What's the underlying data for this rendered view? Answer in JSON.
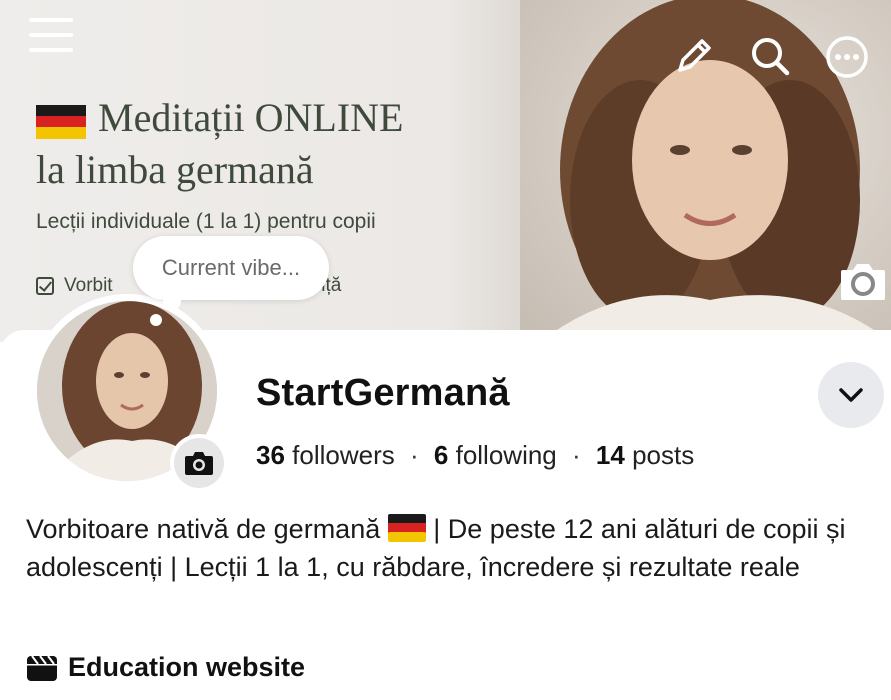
{
  "cover": {
    "title_line1": "Meditații ONLINE",
    "title_line2": "la limba germană",
    "subtitle": "Lecții individuale (1 la 1) pentru copii",
    "check_left": "Vorbit",
    "check_right": "experiență",
    "flag_icon": "germany-flag-icon"
  },
  "note": {
    "text": "Current vibe..."
  },
  "profile": {
    "name": "StartGermană",
    "followers_count": "36",
    "followers_label": "followers",
    "following_count": "6",
    "following_label": "following",
    "posts_count": "14",
    "posts_label": "posts",
    "separator": "·"
  },
  "bio": {
    "part1": "Vorbitoare nativă de germană",
    "part2": "| De peste 12 ani alături de copii și adolescenți | Lecții 1 la 1, cu răbdare, încredere și rezultate reale"
  },
  "category": {
    "label": "Education website",
    "icon": "clapperboard-icon"
  },
  "colors": {
    "cover_text": "#3f4a3c",
    "chevron_bg": "#e8eaee"
  }
}
